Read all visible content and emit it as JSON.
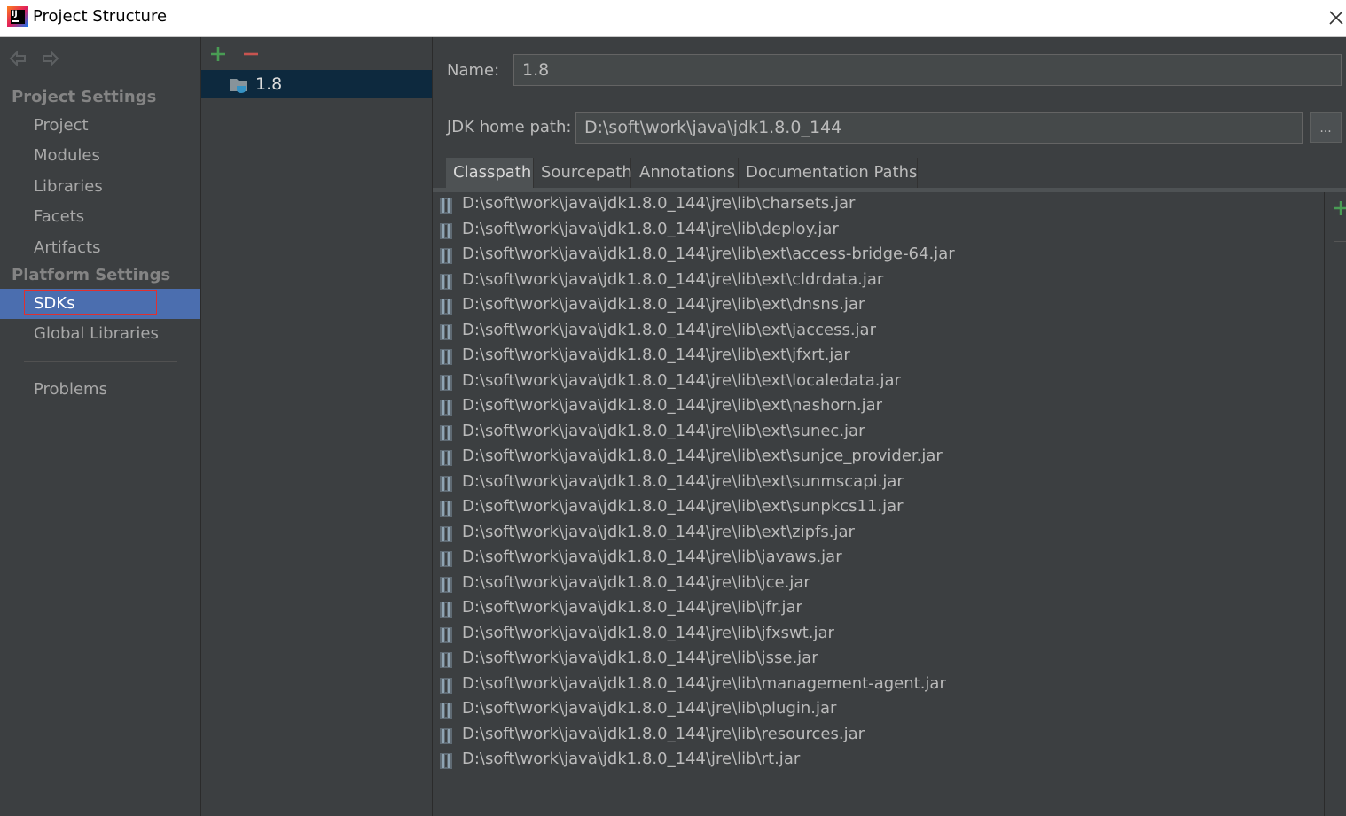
{
  "window": {
    "title": "Project Structure"
  },
  "sidebar": {
    "project_settings_header": "Project Settings",
    "project_items": [
      {
        "label": "Project"
      },
      {
        "label": "Modules"
      },
      {
        "label": "Libraries"
      },
      {
        "label": "Facets"
      },
      {
        "label": "Artifacts"
      }
    ],
    "platform_settings_header": "Platform Settings",
    "platform_items": [
      {
        "label": "SDKs",
        "selected": true
      },
      {
        "label": "Global Libraries"
      }
    ],
    "problems_label": "Problems"
  },
  "sdk_list": {
    "items": [
      {
        "label": "1.8",
        "selected": true
      }
    ]
  },
  "details": {
    "name_label": "Name:",
    "name_value": "1.8",
    "jdk_home_label": "JDK home path:",
    "jdk_home_value": "D:\\soft\\work\\java\\jdk1.8.0_144",
    "browse_label": "...",
    "tabs": [
      {
        "label": "Classpath",
        "active": true
      },
      {
        "label": "Sourcepath"
      },
      {
        "label": "Annotations"
      },
      {
        "label": "Documentation Paths"
      }
    ],
    "classpath": [
      "D:\\soft\\work\\java\\jdk1.8.0_144\\jre\\lib\\charsets.jar",
      "D:\\soft\\work\\java\\jdk1.8.0_144\\jre\\lib\\deploy.jar",
      "D:\\soft\\work\\java\\jdk1.8.0_144\\jre\\lib\\ext\\access-bridge-64.jar",
      "D:\\soft\\work\\java\\jdk1.8.0_144\\jre\\lib\\ext\\cldrdata.jar",
      "D:\\soft\\work\\java\\jdk1.8.0_144\\jre\\lib\\ext\\dnsns.jar",
      "D:\\soft\\work\\java\\jdk1.8.0_144\\jre\\lib\\ext\\jaccess.jar",
      "D:\\soft\\work\\java\\jdk1.8.0_144\\jre\\lib\\ext\\jfxrt.jar",
      "D:\\soft\\work\\java\\jdk1.8.0_144\\jre\\lib\\ext\\localedata.jar",
      "D:\\soft\\work\\java\\jdk1.8.0_144\\jre\\lib\\ext\\nashorn.jar",
      "D:\\soft\\work\\java\\jdk1.8.0_144\\jre\\lib\\ext\\sunec.jar",
      "D:\\soft\\work\\java\\jdk1.8.0_144\\jre\\lib\\ext\\sunjce_provider.jar",
      "D:\\soft\\work\\java\\jdk1.8.0_144\\jre\\lib\\ext\\sunmscapi.jar",
      "D:\\soft\\work\\java\\jdk1.8.0_144\\jre\\lib\\ext\\sunpkcs11.jar",
      "D:\\soft\\work\\java\\jdk1.8.0_144\\jre\\lib\\ext\\zipfs.jar",
      "D:\\soft\\work\\java\\jdk1.8.0_144\\jre\\lib\\javaws.jar",
      "D:\\soft\\work\\java\\jdk1.8.0_144\\jre\\lib\\jce.jar",
      "D:\\soft\\work\\java\\jdk1.8.0_144\\jre\\lib\\jfr.jar",
      "D:\\soft\\work\\java\\jdk1.8.0_144\\jre\\lib\\jfxswt.jar",
      "D:\\soft\\work\\java\\jdk1.8.0_144\\jre\\lib\\jsse.jar",
      "D:\\soft\\work\\java\\jdk1.8.0_144\\jre\\lib\\management-agent.jar",
      "D:\\soft\\work\\java\\jdk1.8.0_144\\jre\\lib\\plugin.jar",
      "D:\\soft\\work\\java\\jdk1.8.0_144\\jre\\lib\\resources.jar",
      "D:\\soft\\work\\java\\jdk1.8.0_144\\jre\\lib\\rt.jar"
    ]
  },
  "colors": {
    "add": "#499c54",
    "remove": "#c75450",
    "selection": "#4b6eaf",
    "highlight_box": "#e03030"
  }
}
